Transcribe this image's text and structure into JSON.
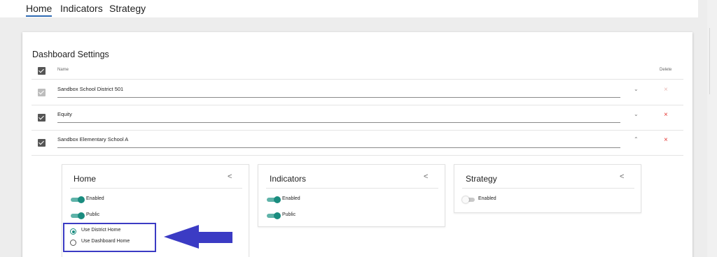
{
  "nav": {
    "tabs": [
      "Home",
      "Indicators",
      "Strategy"
    ],
    "active_color": "#2e6ab3"
  },
  "settings": {
    "title": "Dashboard Settings",
    "header": {
      "name": "Name",
      "delete": "Delete"
    },
    "rows": [
      {
        "name": "Sandbox School District 501",
        "checked": true,
        "disabled": true,
        "chevron": "⌄",
        "delete": "×"
      },
      {
        "name": "Equity",
        "checked": true,
        "disabled": false,
        "chevron": "⌄",
        "delete": "×"
      },
      {
        "name": "Sandbox Elementary School A",
        "checked": true,
        "disabled": false,
        "chevron": "⌃",
        "delete": "×"
      }
    ]
  },
  "panels": {
    "home": {
      "title": "Home",
      "share_icon": "share-icon",
      "enabled": "Enabled",
      "public": "Public",
      "radio": {
        "district": "Use District Home",
        "dashboard": "Use Dashboard Home",
        "selected": "district"
      }
    },
    "indicators": {
      "title": "Indicators",
      "share_icon": "share-icon",
      "enabled": "Enabled",
      "public": "Public"
    },
    "strategy": {
      "title": "Strategy",
      "share_icon": "share-icon",
      "enabled": "Enabled",
      "enabled_state": false
    }
  },
  "colors": {
    "toggle_on": "#1a8c7f",
    "delete": "#e53935",
    "highlight_box": "#3b3bc4",
    "arrow": "#3b3bc4"
  }
}
